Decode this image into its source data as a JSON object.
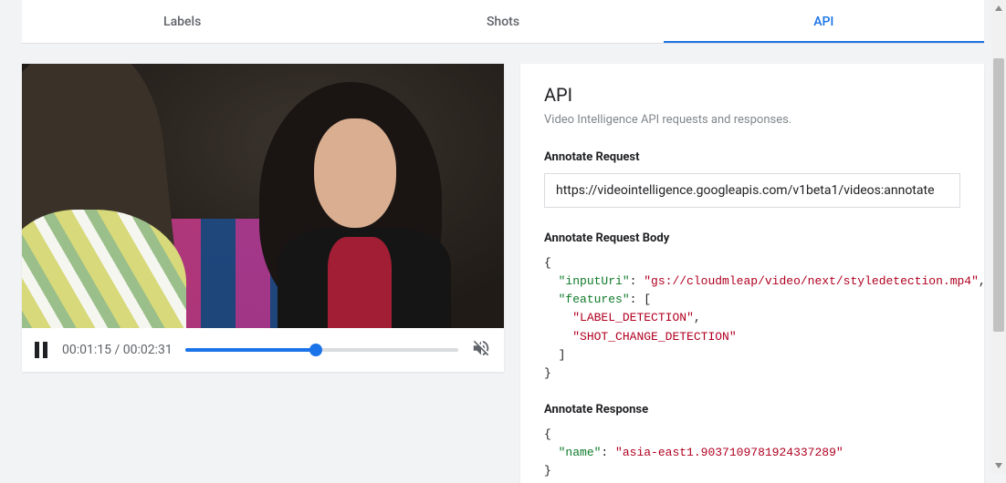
{
  "tabs": {
    "labels": "Labels",
    "shots": "Shots",
    "api": "API"
  },
  "video": {
    "current_time": "00:01:15",
    "duration": "00:02:31",
    "progress_percent": 48,
    "paused": false,
    "muted": true
  },
  "panel": {
    "heading": "API",
    "subtitle": "Video Intelligence API requests and responses.",
    "annotate_request_label": "Annotate Request",
    "annotate_request_url": "https://videointelligence.googleapis.com/v1beta1/videos:annotate",
    "annotate_request_body_label": "Annotate Request Body",
    "annotate_request_body": {
      "inputUri": "gs://cloudmleap/video/next/styledetection.mp4",
      "features": [
        "LABEL_DETECTION",
        "SHOT_CHANGE_DETECTION"
      ]
    },
    "annotate_response_label": "Annotate Response",
    "annotate_response": {
      "name": "asia-east1.9037109781924337289"
    }
  },
  "colors": {
    "accent": "#1a73e8",
    "code_string": "#b00020",
    "code_key": "#0f7b2a"
  }
}
